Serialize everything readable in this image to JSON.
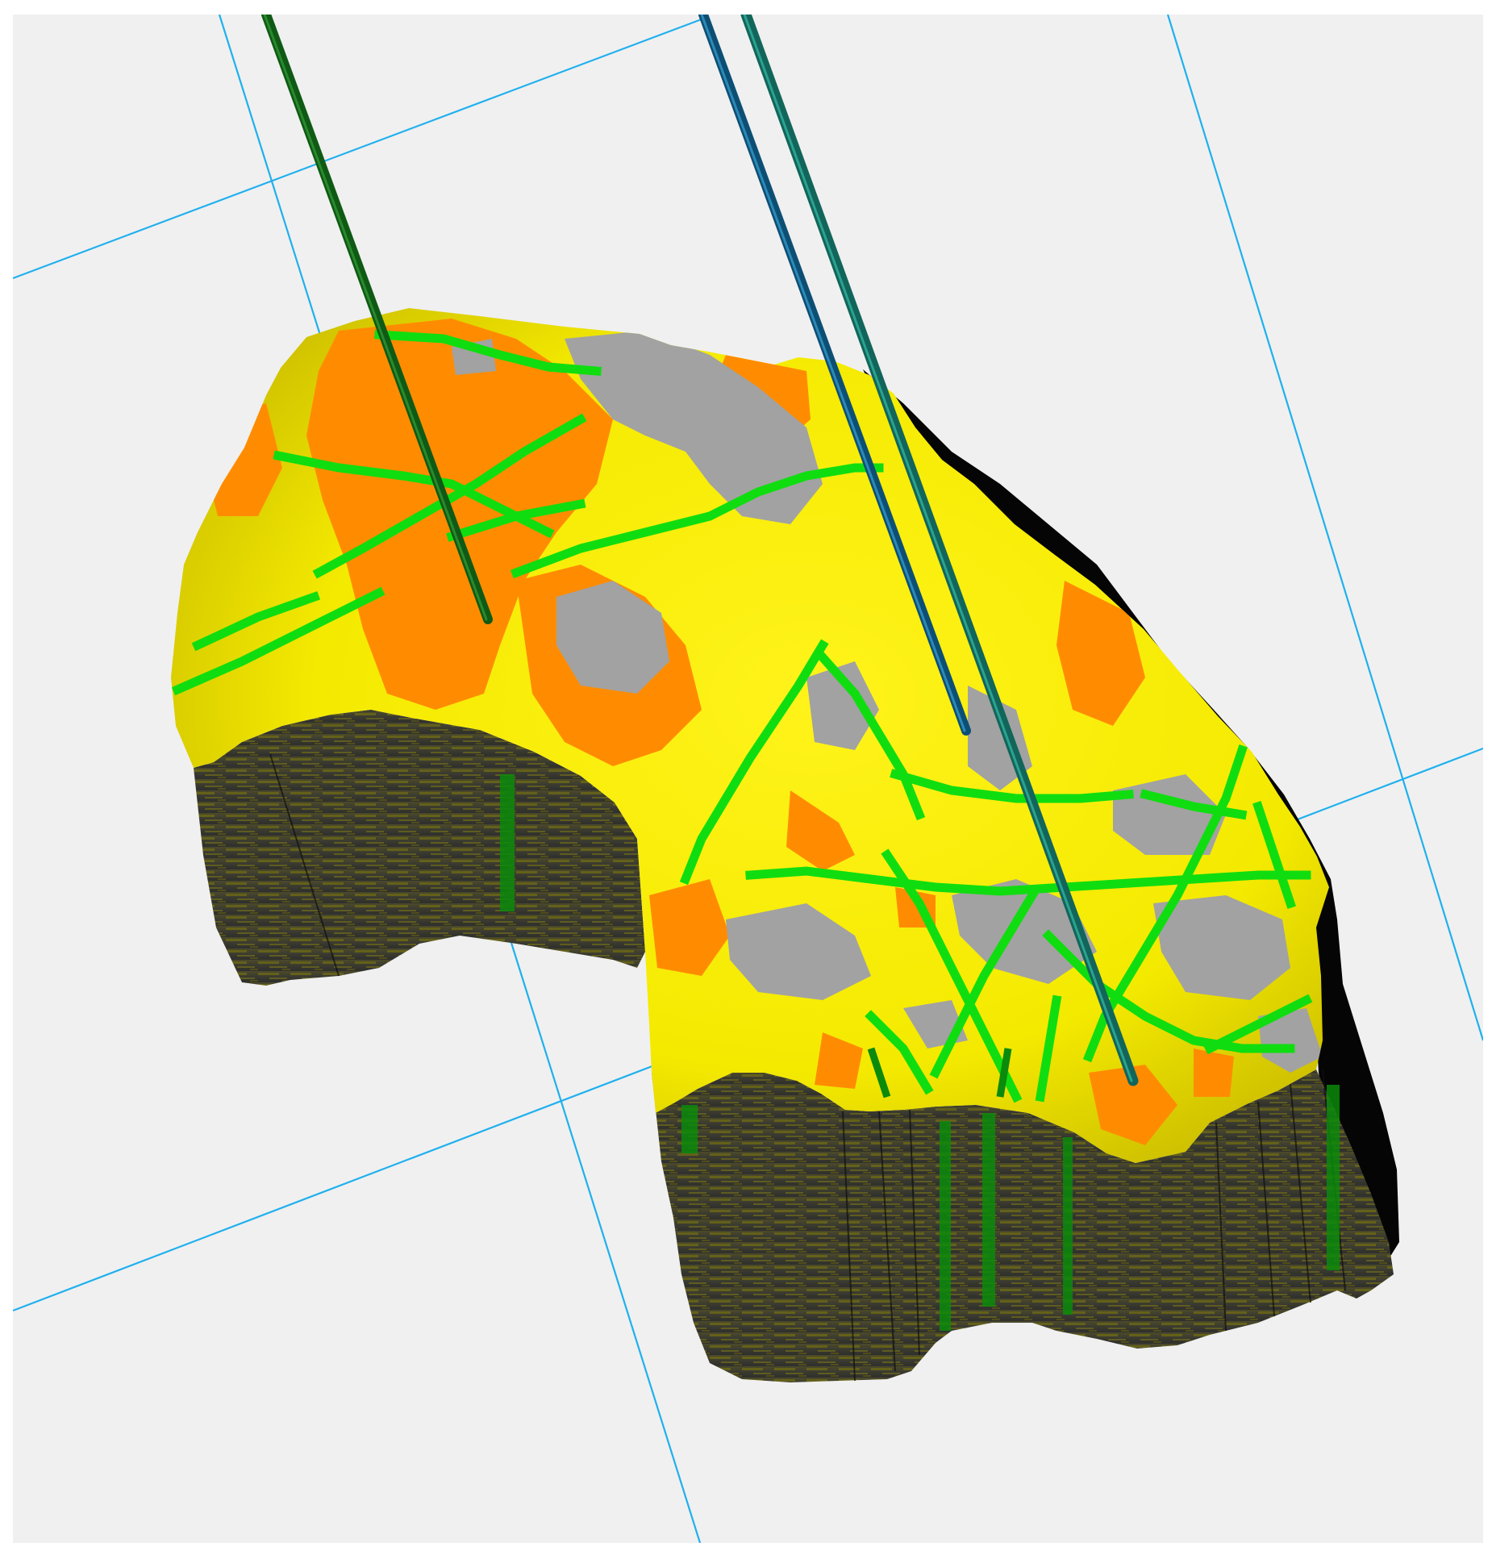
{
  "viewport": {
    "background_color": "#f0f0f0",
    "frame_color": "#ffffff"
  },
  "colors": {
    "grid_line": "#1fb0ee",
    "yellow": "#f6ec00",
    "yellow_dark": "#c9bb00",
    "orange": "#ff8c00",
    "orange_light": "#ffa21a",
    "gray": "#a2a2a2",
    "gray_light": "#bcbcbc",
    "green": "#10dd10",
    "green_dark": "#0b8a0b",
    "side_dark": "#3a3a33",
    "side_olive": "#6e6a14",
    "shadow": "#050505",
    "well_green": "#0f5a14",
    "well_blue": "#0d4f74",
    "well_teal": "#12655a"
  },
  "objects": {
    "grid_lines": "reference-grid",
    "body": "reservoir-grid-model",
    "wells": [
      "well-trajectory-1",
      "well-trajectory-2",
      "well-trajectory-3"
    ]
  }
}
